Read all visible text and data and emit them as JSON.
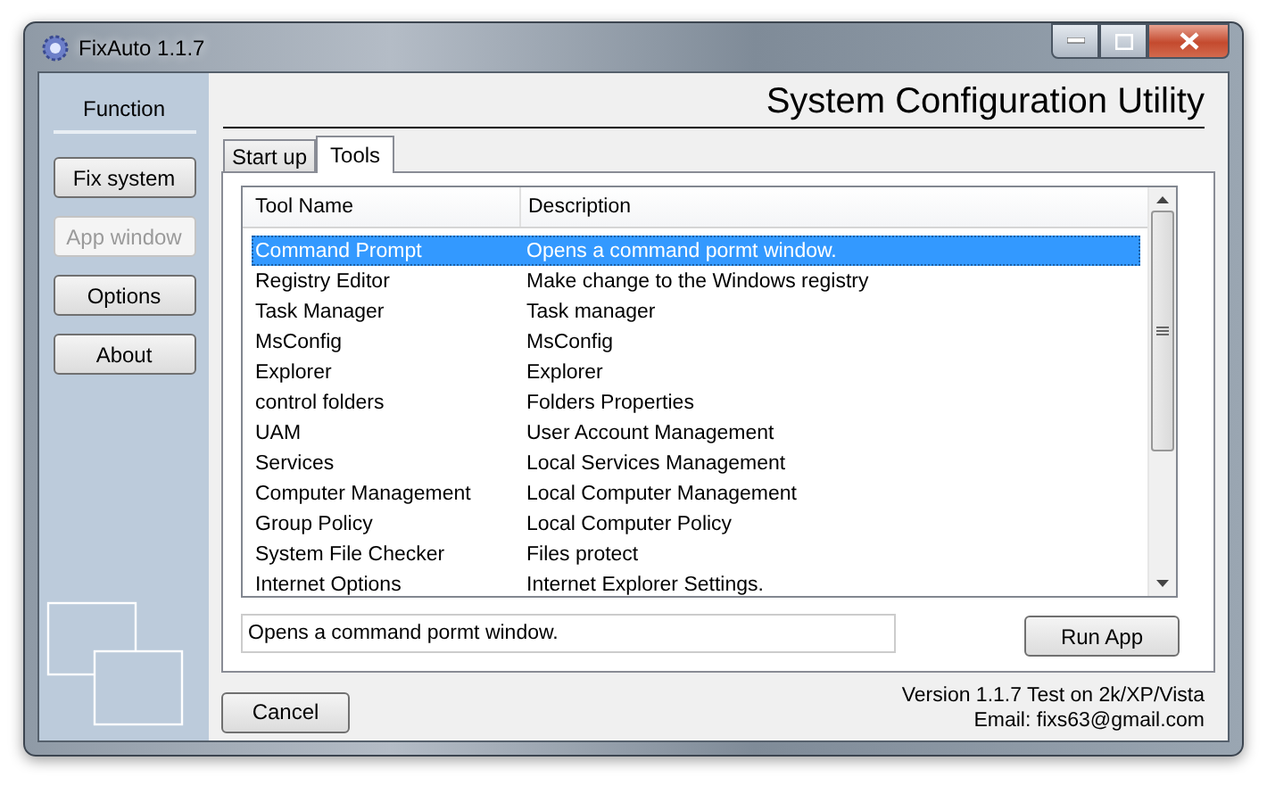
{
  "window": {
    "title": "FixAuto 1.1.7"
  },
  "sidebar": {
    "heading": "Function",
    "buttons": [
      {
        "label": "Fix system",
        "disabled": false
      },
      {
        "label": "App window",
        "disabled": true
      },
      {
        "label": "Options",
        "disabled": false
      },
      {
        "label": "About",
        "disabled": false
      }
    ]
  },
  "header": {
    "title": "System Configuration Utility"
  },
  "tabs": [
    {
      "label": "Start up",
      "selected": false
    },
    {
      "label": "Tools",
      "selected": true
    }
  ],
  "table": {
    "columns": [
      "Tool Name",
      "Description"
    ],
    "rows": [
      {
        "name": "Command Prompt",
        "description": "Opens a command pormt window.",
        "selected": true
      },
      {
        "name": "Registry Editor",
        "description": "Make change to the Windows registry",
        "selected": false
      },
      {
        "name": "Task Manager",
        "description": "Task manager",
        "selected": false
      },
      {
        "name": "MsConfig",
        "description": "MsConfig",
        "selected": false
      },
      {
        "name": "Explorer",
        "description": "Explorer",
        "selected": false
      },
      {
        "name": "control folders",
        "description": "Folders Properties",
        "selected": false
      },
      {
        "name": "UAM",
        "description": "User Account Management",
        "selected": false
      },
      {
        "name": "Services",
        "description": "Local Services Management",
        "selected": false
      },
      {
        "name": "Computer Management",
        "description": "Local Computer Management",
        "selected": false
      },
      {
        "name": "Group Policy",
        "description": "Local Computer Policy",
        "selected": false
      },
      {
        "name": "System File Checker",
        "description": "Files protect",
        "selected": false
      },
      {
        "name": "Internet Options",
        "description": "Internet Explorer Settings.",
        "selected": false
      }
    ]
  },
  "description_field": {
    "value": "Opens a command pormt window."
  },
  "run_button": "Run App",
  "cancel_button": "Cancel",
  "info": [
    "Version 1.1.7 Test on 2k/XP/Vista",
    "Email: fixs63@gmail.com"
  ]
}
